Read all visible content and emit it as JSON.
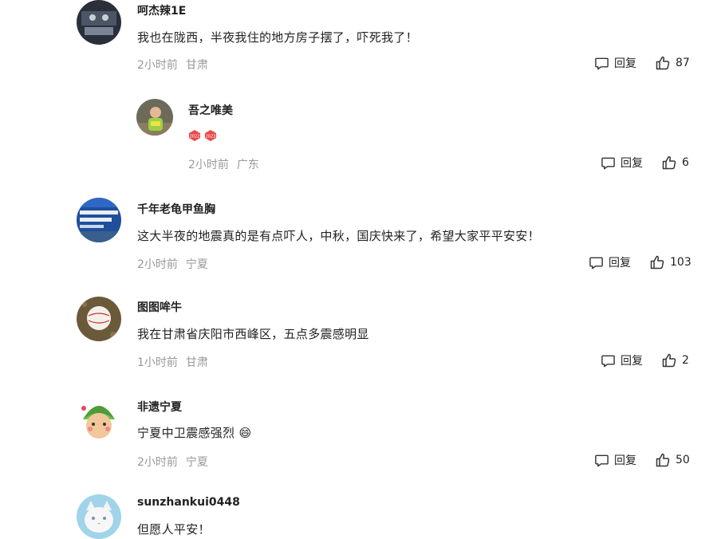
{
  "comments": [
    {
      "user": "呵杰辣1E",
      "text": "我也在陇西，半夜我住的地方房子摆了，吓死我了！",
      "time": "2小时前",
      "location": "甘肃",
      "reply_label": "回复",
      "likes": "87"
    },
    {
      "user": "吾之唯美",
      "time": "2小时前",
      "location": "广东",
      "reply_label": "回复",
      "likes": "6",
      "badges": [
        "2022",
        "2023"
      ]
    },
    {
      "user": "千年老龟甲鱼胸",
      "text": "这大半夜的地震真的是有点吓人，中秋，国庆快来了，希望大家平平安安！",
      "time": "2小时前",
      "location": "宁夏",
      "reply_label": "回复",
      "likes": "103"
    },
    {
      "user": "图图哞牛",
      "text": "我在甘肃省庆阳市西峰区，五点多震感明显",
      "time": "1小时前",
      "location": "甘肃",
      "reply_label": "回复",
      "likes": "2"
    },
    {
      "user": "非遗宁夏",
      "text": "宁夏中卫震感强烈",
      "emoji": "😄",
      "time": "2小时前",
      "location": "宁夏",
      "reply_label": "回复",
      "likes": "50"
    },
    {
      "user": "sunzhankui0448",
      "text": "但愿人平安！"
    }
  ]
}
